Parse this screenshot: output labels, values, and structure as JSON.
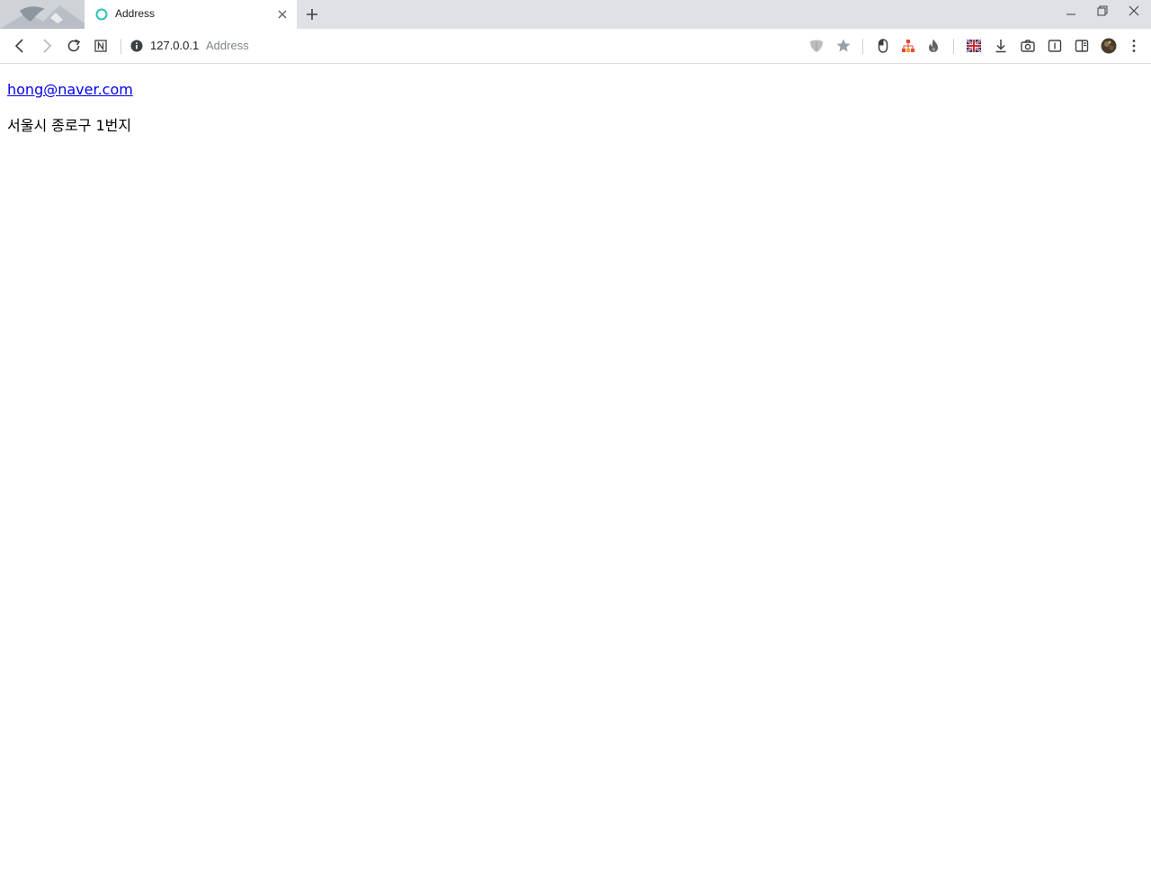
{
  "browser": {
    "tab": {
      "title": "Address",
      "favicon": "circle-icon",
      "favicon_color": "#2ec4b6"
    },
    "new_tab_icon": "plus-icon",
    "window_controls": [
      "minimize-icon",
      "restore-icon",
      "close-icon"
    ],
    "address_bar": {
      "host": "127.0.0.1",
      "page_title": "Address",
      "security_icon": "info-icon"
    },
    "toolbar_icons": [
      "back-icon",
      "forward-icon",
      "reload-icon",
      "notion-icon",
      "shield-icon",
      "bookmark-star-icon",
      "mouse-extension-icon",
      "sitemap-extension-icon",
      "fire-extension-icon",
      "flag-extension-icon",
      "download-icon",
      "camera-icon",
      "reader-mode-icon",
      "sidebar-icon",
      "profile-avatar",
      "menu-kebab-icon"
    ]
  },
  "page": {
    "email": "hong@naver.com",
    "address": "서울시 종로구 1번지",
    "link_color": "#0000ee"
  }
}
